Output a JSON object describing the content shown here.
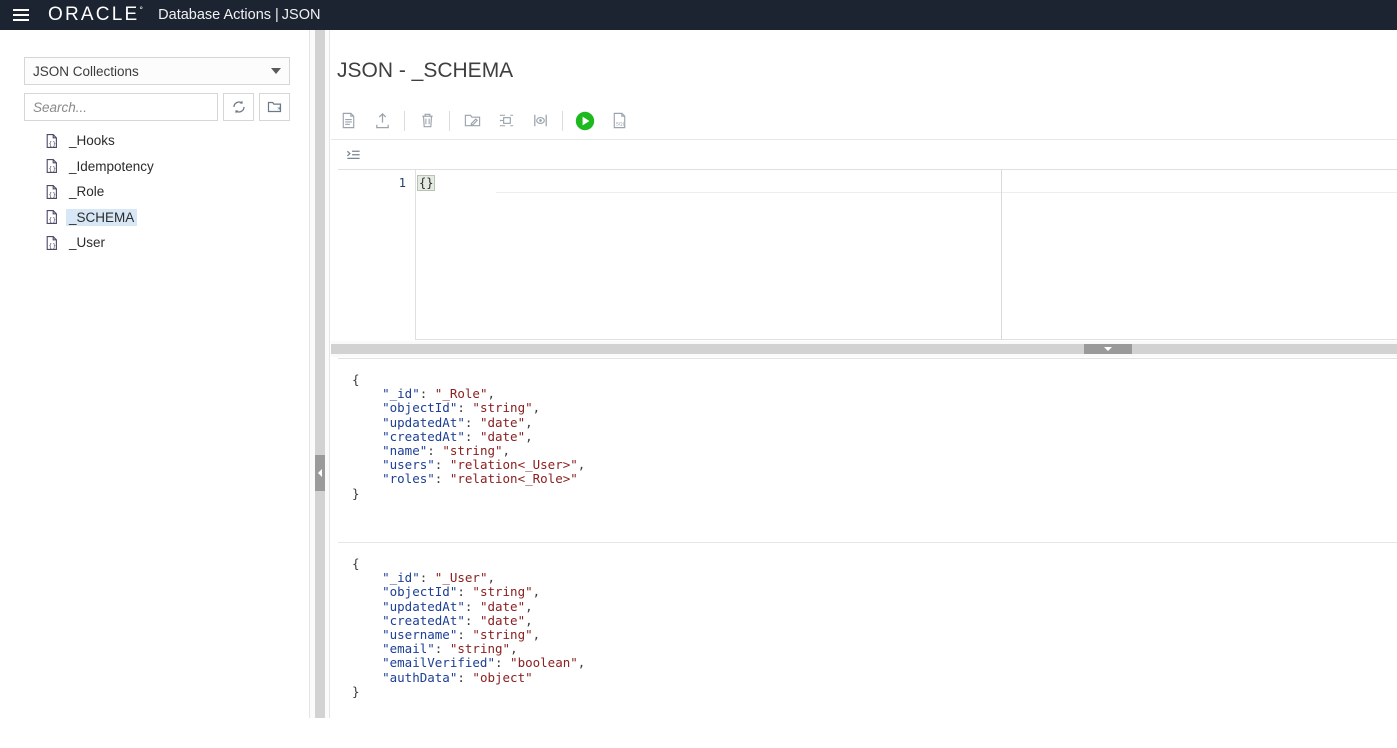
{
  "header": {
    "menu_icon": "hamburger-menu-icon",
    "brand": "ORACLE",
    "app_title": "Database Actions",
    "separator": "|",
    "module": "JSON"
  },
  "sidebar": {
    "collection_select": {
      "value": "JSON Collections",
      "caret_icon": "chevron-down-icon"
    },
    "search": {
      "value": "",
      "placeholder": "Search..."
    },
    "buttons": [
      {
        "name": "refresh-button",
        "icon": "refresh-icon"
      },
      {
        "name": "new-collection-button",
        "icon": "new-collection-folder-icon"
      }
    ],
    "tree_items": [
      {
        "label": "_Hooks",
        "icon": "json-collection-icon",
        "selected": false
      },
      {
        "label": "_Idempotency",
        "icon": "json-collection-icon",
        "selected": false
      },
      {
        "label": "_Role",
        "icon": "json-collection-icon",
        "selected": false
      },
      {
        "label": "_SCHEMA",
        "icon": "json-collection-icon",
        "selected": true
      },
      {
        "label": "_User",
        "icon": "json-collection-icon",
        "selected": false
      }
    ]
  },
  "main": {
    "panel_title": "JSON - _SCHEMA",
    "toolbar": [
      {
        "name": "new-document-button",
        "icon": "document-icon",
        "title": "New JSON Document"
      },
      {
        "name": "import-button",
        "icon": "upload-icon",
        "title": "Load Data"
      },
      {
        "name": "delete-button",
        "icon": "trash-icon",
        "title": "Delete"
      },
      {
        "name": "edit-collection-button",
        "icon": "folder-edit-icon",
        "title": "Edit"
      },
      {
        "name": "structure-button",
        "icon": "structure-icon",
        "title": "JSON Data Guide"
      },
      {
        "name": "preview-button",
        "icon": "preview-eye-icon",
        "title": "Preview"
      },
      {
        "name": "run-button",
        "icon": "play-icon",
        "title": "Run"
      },
      {
        "name": "sql-button",
        "icon": "sql-document-icon",
        "title": "SQL"
      }
    ],
    "editor_toolbar": [
      {
        "name": "format-button",
        "icon": "indent-format-icon"
      }
    ],
    "editor": {
      "line_numbers": [
        "1"
      ],
      "content": "{}"
    },
    "splitter_horizontal_icon": "collapse-down-icon",
    "splitter_vertical_icon": "collapse-left-icon",
    "results": [
      {
        "open_brace": "{",
        "close_brace": "}",
        "fields": [
          {
            "key": "_id",
            "value": "_Role",
            "comma": true
          },
          {
            "key": "objectId",
            "value": "string",
            "comma": true
          },
          {
            "key": "updatedAt",
            "value": "date",
            "comma": true
          },
          {
            "key": "createdAt",
            "value": "date",
            "comma": true
          },
          {
            "key": "name",
            "value": "string",
            "comma": true
          },
          {
            "key": "users",
            "value": "relation<_User>",
            "comma": true
          },
          {
            "key": "roles",
            "value": "relation<_Role>",
            "comma": false
          }
        ]
      },
      {
        "open_brace": "{",
        "close_brace": "}",
        "fields": [
          {
            "key": "_id",
            "value": "_User",
            "comma": true
          },
          {
            "key": "objectId",
            "value": "string",
            "comma": true
          },
          {
            "key": "updatedAt",
            "value": "date",
            "comma": true
          },
          {
            "key": "createdAt",
            "value": "date",
            "comma": true
          },
          {
            "key": "username",
            "value": "string",
            "comma": true
          },
          {
            "key": "email",
            "value": "string",
            "comma": true
          },
          {
            "key": "emailVerified",
            "value": "boolean",
            "comma": true
          },
          {
            "key": "authData",
            "value": "object",
            "comma": false
          }
        ]
      }
    ]
  },
  "colors": {
    "topbar_bg": "#1c2331",
    "selection_bg": "#d7e7f5",
    "run_green": "#1eb91e",
    "json_key": "#1c3f94",
    "json_string": "#8a2020",
    "splitter": "#d2d2d2"
  }
}
